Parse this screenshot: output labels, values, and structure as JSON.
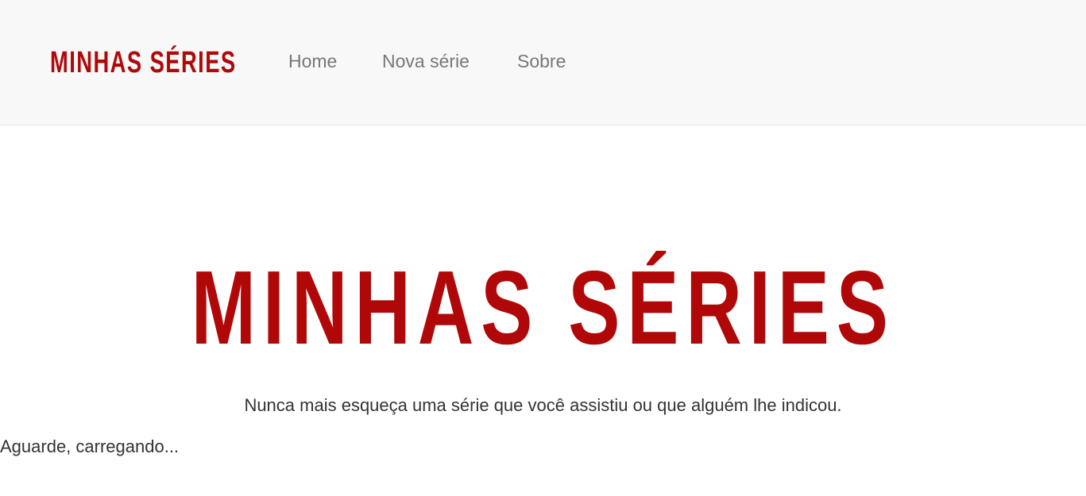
{
  "navbar": {
    "brand": "MINHAS SÉRIES",
    "links": [
      {
        "label": "Home"
      },
      {
        "label": "Nova série"
      },
      {
        "label": "Sobre"
      }
    ]
  },
  "hero": {
    "logo_text": "MINHAS SÉRIES",
    "tagline": "Nunca mais esqueça uma série que você assistiu ou que alguém lhe indicou."
  },
  "status": {
    "loading_text": "Aguarde, carregando..."
  },
  "colors": {
    "brand_red": "#b00808",
    "navbar_bg": "#f8f8f8",
    "nav_link": "#777777",
    "text": "#333333"
  }
}
